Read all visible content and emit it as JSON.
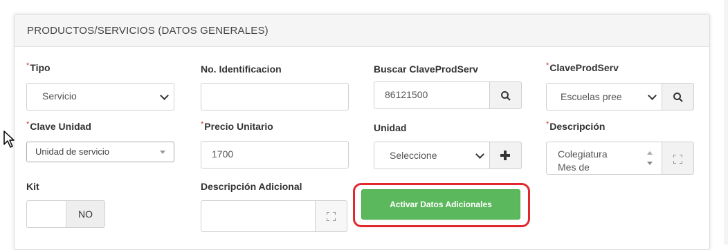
{
  "panel": {
    "title": "PRODUCTOS/SERVICIOS (DATOS GENERALES)"
  },
  "fields": {
    "tipo": {
      "label": "Tipo",
      "value": "Servicio"
    },
    "no_identificacion": {
      "label": "No. Identificacion",
      "value": ""
    },
    "buscar_clave": {
      "label": "Buscar ClaveProdServ",
      "value": "86121500"
    },
    "clave_prod_serv": {
      "label": "ClaveProdServ",
      "value": "Escuelas pree"
    },
    "clave_unidad": {
      "label": "Clave Unidad",
      "value": "Unidad de servicio"
    },
    "precio_unitario": {
      "label": "Precio Unitario",
      "value": "1700"
    },
    "unidad": {
      "label": "Unidad",
      "value": "Seleccione"
    },
    "descripcion": {
      "label": "Descripción",
      "line1": "Colegiatura",
      "line2": "Mes de"
    },
    "kit": {
      "label": "Kit",
      "value": "NO"
    },
    "descripcion_adicional": {
      "label": "Descripción Adicional",
      "value": ""
    }
  },
  "required_marker": "*",
  "buttons": {
    "activar": "Activar Datos Adicionales"
  },
  "icons": {
    "search": "search-icon",
    "plus": "plus-icon",
    "expand": "expand-icon",
    "dropdown": "chevron-down-icon",
    "spinner": "spinner-arrows-icon",
    "cursor": "cursor-pointer-icon"
  },
  "colors": {
    "accent_green": "#5cb85c",
    "required_red": "#d9342b",
    "highlight_red": "#e3272f"
  }
}
